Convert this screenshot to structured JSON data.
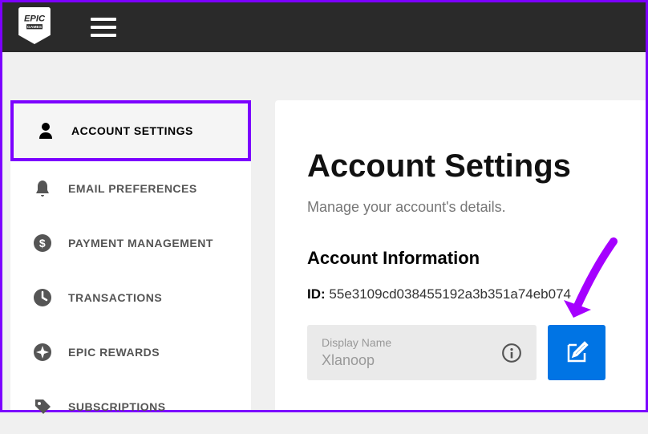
{
  "sidebar": [
    {
      "label": "ACCOUNT SETTINGS"
    },
    {
      "label": "EMAIL PREFERENCES"
    },
    {
      "label": "PAYMENT MANAGEMENT"
    },
    {
      "label": "TRANSACTIONS"
    },
    {
      "label": "EPIC REWARDS"
    },
    {
      "label": "SUBSCRIPTIONS"
    }
  ],
  "main": {
    "title": "Account Settings",
    "subtitle": "Manage your account's details.",
    "section": "Account Information",
    "id_label": "ID:",
    "id_value": "55e3109cd038455192a3b351a74eb074",
    "display_name_label": "Display Name",
    "display_name_value": "Xlanoop"
  },
  "colors": {
    "accent": "#7c00ff",
    "primary": "#0074e4"
  }
}
